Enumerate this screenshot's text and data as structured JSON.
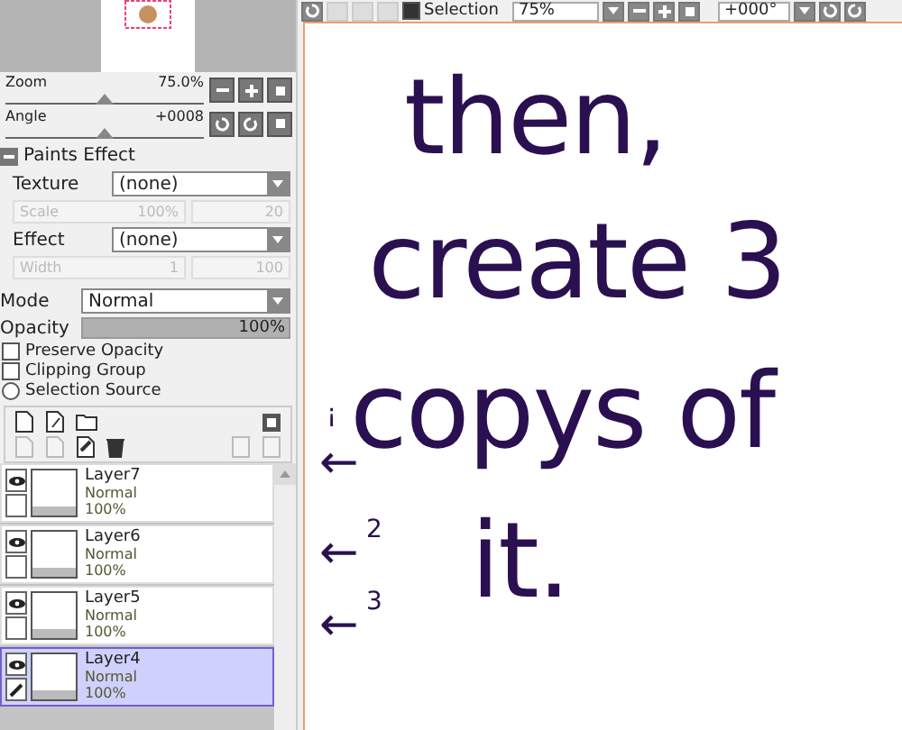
{
  "navigator": {
    "zoom": {
      "label": "Zoom",
      "value": "75.0%",
      "level": 0.5
    },
    "angle": {
      "label": "Angle",
      "value": "+0008",
      "level": 0.5
    }
  },
  "paints_effect": {
    "title": "Paints Effect",
    "expanded": true,
    "texture": {
      "label": "Texture",
      "value": "(none)"
    },
    "scale": {
      "label": "Scale",
      "value": "100%",
      "amount": "20"
    },
    "effect": {
      "label": "Effect",
      "value": "(none)"
    },
    "width": {
      "label": "Width",
      "value": "1",
      "amount": "100"
    }
  },
  "layer_props": {
    "mode_label": "Mode",
    "mode": "Normal",
    "opacity_label": "Opacity",
    "opacity": {
      "value": "100%",
      "level": 1
    },
    "options": [
      {
        "label": "Preserve Opacity",
        "kind": "checkbox",
        "checked": false
      },
      {
        "label": "Clipping Group",
        "kind": "checkbox",
        "checked": false
      },
      {
        "label": "Selection Source",
        "kind": "radio",
        "checked": false
      }
    ]
  },
  "layers": [
    {
      "name": "Layer7",
      "mode": "Normal",
      "opacity": "100%",
      "visible": true,
      "selected": false
    },
    {
      "name": "Layer6",
      "mode": "Normal",
      "opacity": "100%",
      "visible": true,
      "selected": false
    },
    {
      "name": "Layer5",
      "mode": "Normal",
      "opacity": "100%",
      "visible": true,
      "selected": false
    },
    {
      "name": "Layer4",
      "mode": "Normal",
      "opacity": "100%",
      "visible": true,
      "selected": true
    }
  ],
  "toolbar": {
    "selection": {
      "label": "Selection",
      "checked": true
    },
    "zoom": "75%",
    "angle": "+000°"
  },
  "canvas": {
    "lines": [
      "then,",
      "create 3",
      "copys of",
      "it."
    ],
    "arrows": [
      {
        "arrow": "←",
        "number": "¡"
      },
      {
        "arrow": "←",
        "number": "2"
      },
      {
        "arrow": "←",
        "number": "3"
      }
    ]
  }
}
